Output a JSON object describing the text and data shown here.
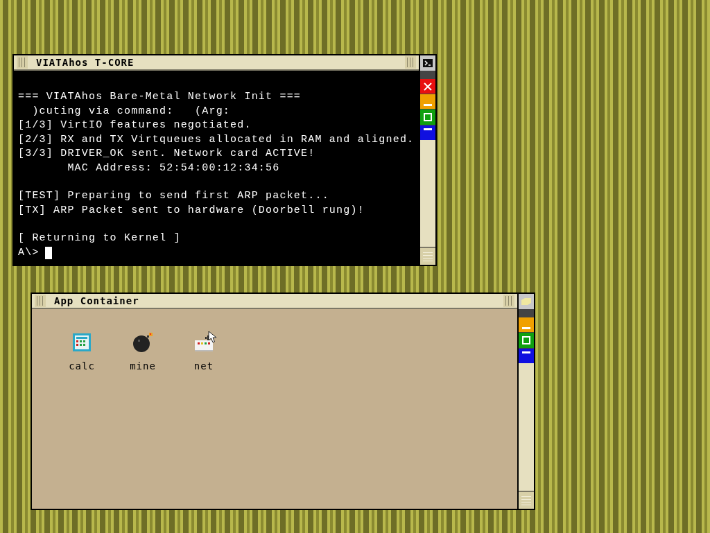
{
  "terminal_window": {
    "title": "VIATAhos T-CORE",
    "blocks": [
      [
        "=== VIATAhos Bare-Metal Network Init ===",
        "  )cuting via command:   (Arg:",
        "[1/3] VirtIO features negotiated.",
        "[2/3] RX and TX Virtqueues allocated in RAM and aligned.",
        "[3/3] DRIVER_OK sent. Network card ACTIVE!",
        "       MAC Address: 52:54:00:12:34:56"
      ],
      [
        "[TEST] Preparing to send first ARP packet...",
        "[TX] ARP Packet sent to hardware (Doorbell rung)!"
      ],
      [
        "[ Returning to Kernel ]"
      ]
    ],
    "prompt": "A\\>"
  },
  "app_window": {
    "title": "App Container",
    "apps": [
      {
        "label": "calc",
        "kind": "calc"
      },
      {
        "label": "mine",
        "kind": "mine"
      },
      {
        "label": "net",
        "kind": "net"
      }
    ]
  }
}
